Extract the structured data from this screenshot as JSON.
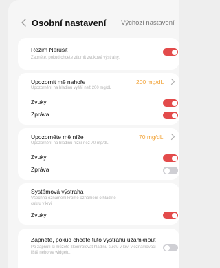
{
  "header": {
    "title": "Osobní nastavení",
    "default_link": "Výchozí nastavení"
  },
  "do_not_disturb": {
    "title": "Režim Nerušit",
    "subtitle": "Zapněte, pokud chcete ztlumit zvukové výstrahy.",
    "enabled": true
  },
  "high_alert": {
    "title": "Upozornit mě nahoře",
    "subtitle": "Upozornění na hladinu vyšší než 200 mg/dL",
    "value": "200 mg/dL",
    "sound_label": "Zvuky",
    "sound_enabled": true,
    "message_label": "Zpráva",
    "message_enabled": true
  },
  "low_alert": {
    "title": "Upozorněte mě níže",
    "subtitle": "Upozornění na hladinu nižší než 70 mg/dL",
    "value": "70 mg/dL",
    "sound_label": "Zvuky",
    "sound_enabled": true,
    "message_label": "Zpráva",
    "message_enabled": false
  },
  "system_alert": {
    "title": "Systémová výstraha",
    "subtitle": "Všechna oznámení kromě oznámení o hladině cukru v krvi",
    "sound_label": "Zvuky",
    "sound_enabled": true
  },
  "lock_alert": {
    "title": "Zapněte, pokud chcete tuto výstrahu uzamknout",
    "subtitle": "Po zapnutí si můžete zkontrolovat hladinu cukru v krvi v oznamovací liště nebo ve widgetu.",
    "enabled": false
  },
  "colors": {
    "toggle_on": "#e34b4b",
    "toggle_off": "#cfcfd4",
    "value_accent": "#f2a43a"
  },
  "icons": {
    "back": "chevron-left-icon",
    "disclosure": "chevron-right-icon"
  }
}
